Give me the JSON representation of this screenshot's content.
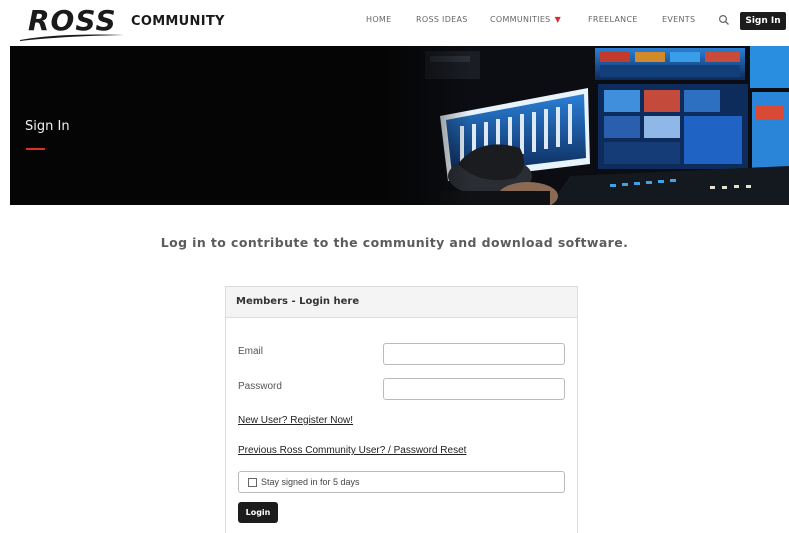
{
  "header": {
    "logo_text": "ROSS",
    "community_text": "COMMUNITY",
    "nav": [
      "HOME",
      "ROSS IDEAS",
      "COMMUNITIES",
      "FREELANCE",
      "EVENTS"
    ],
    "signin_label": "Sign In",
    "icons": {
      "search": "search-icon",
      "dropdown": "chevron-down-icon"
    }
  },
  "hero": {
    "title": "Sign In"
  },
  "tagline": "Log in to contribute to the community and download software.",
  "login": {
    "panel_title": "Members - Login here",
    "email_label": "Email",
    "email_value": "",
    "password_label": "Password",
    "password_value": "",
    "register_link": "New User? Register Now!",
    "reset_link": "Previous Ross Community User? / Password Reset",
    "stay_signed_in": "Stay signed in for 5 days",
    "stay_checked": false,
    "login_button": "Login"
  },
  "colors": {
    "accent": "#d9302c",
    "dark": "#1c1c1c"
  }
}
